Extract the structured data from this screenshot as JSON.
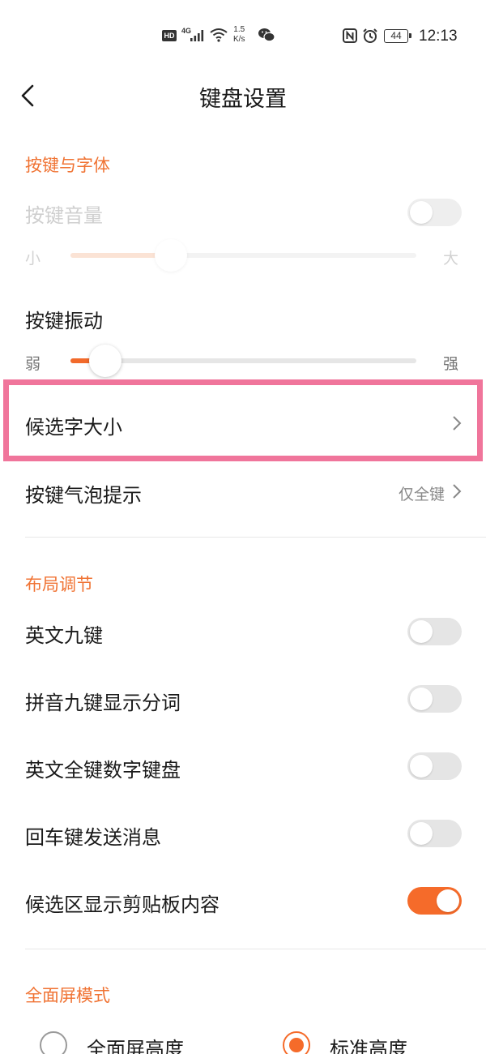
{
  "status_bar": {
    "hd": "HD",
    "network": "4G",
    "speed_value": "1.5",
    "speed_unit": "K/s",
    "battery": "44",
    "time": "12:13",
    "icons": [
      "signal-icon",
      "wifi-icon",
      "wechat-icon",
      "nfc-icon",
      "alarm-icon",
      "battery-icon"
    ]
  },
  "header": {
    "title": "键盘设置",
    "back_icon": "chevron-left-icon"
  },
  "sections": {
    "keys_fonts": {
      "label": "按键与字体",
      "key_volume": {
        "label": "按键音量",
        "enabled": false,
        "toggle_on": false,
        "slider_min": "小",
        "slider_max": "大",
        "slider_level": 0.29
      },
      "key_vibration": {
        "label": "按键振动",
        "slider_min": "弱",
        "slider_max": "强",
        "slider_level": 0.1
      },
      "candidate_size": {
        "label": "候选字大小"
      },
      "key_bubble": {
        "label": "按键气泡提示",
        "value": "仅全键"
      }
    },
    "layout": {
      "label": "布局调节",
      "items": [
        {
          "label": "英文九键",
          "on": false
        },
        {
          "label": "拼音九键显示分词",
          "on": false
        },
        {
          "label": "英文全键数字键盘",
          "on": false
        },
        {
          "label": "回车键发送消息",
          "on": false
        },
        {
          "label": "候选区显示剪贴板内容",
          "on": true
        }
      ]
    },
    "fullscreen": {
      "label": "全面屏模式",
      "options": [
        {
          "label": "全面屏高度",
          "checked": false
        },
        {
          "label": "标准高度",
          "checked": true
        }
      ]
    }
  },
  "colors": {
    "accent": "#f56b2a",
    "section_label": "#f07333",
    "highlight": "#f0759b"
  }
}
